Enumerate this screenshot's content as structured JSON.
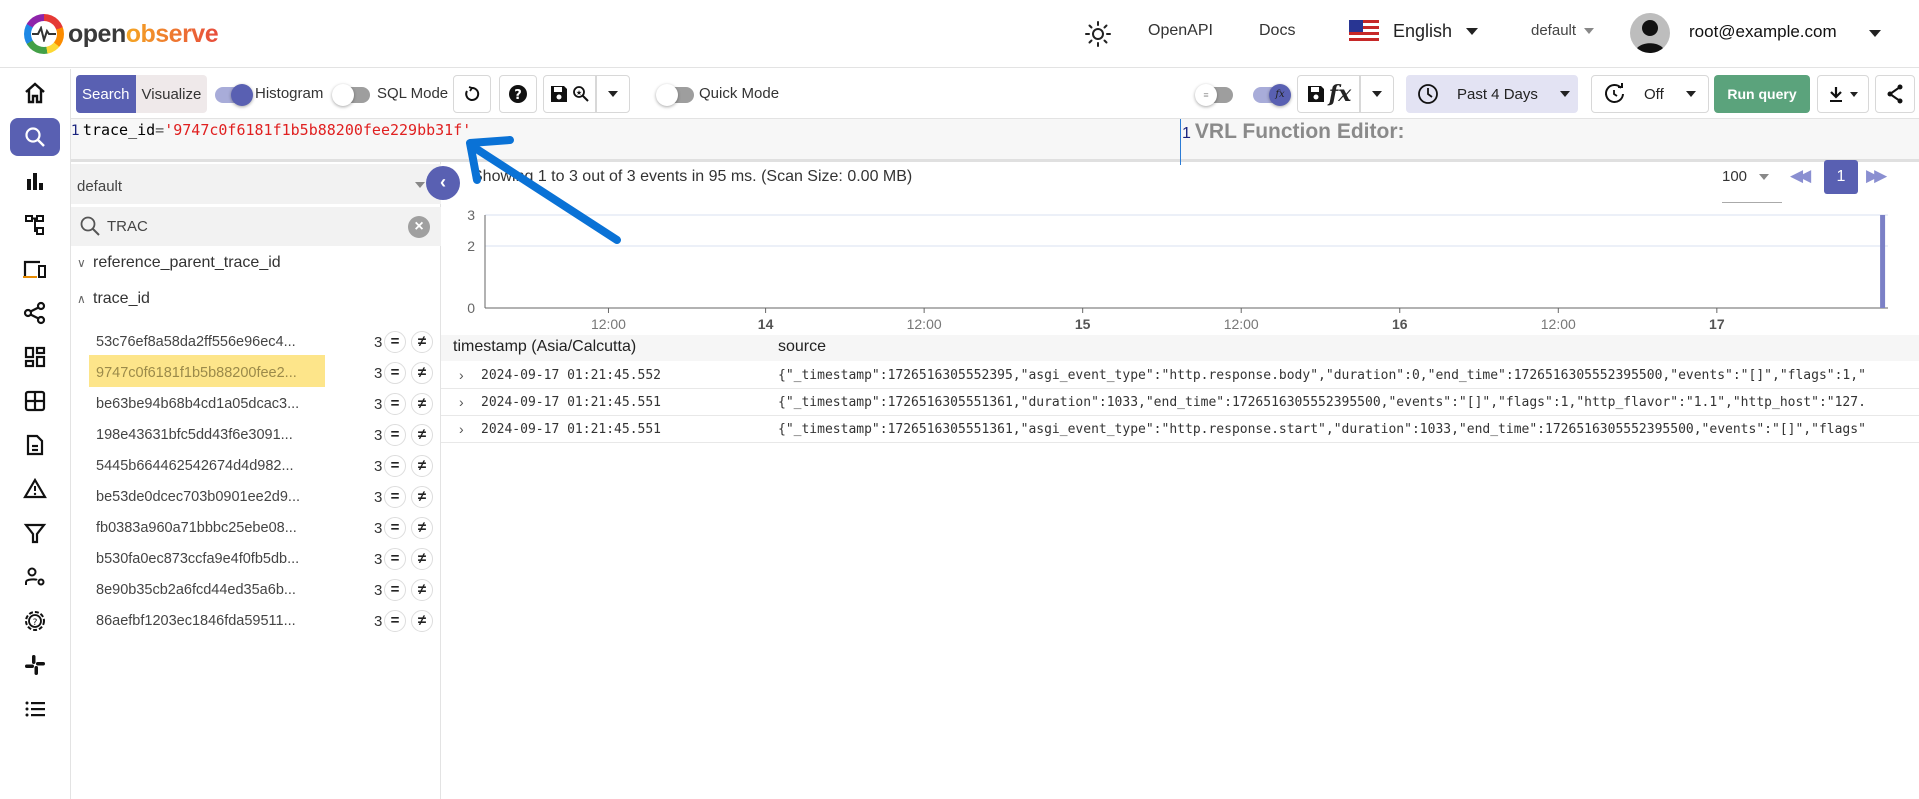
{
  "header": {
    "logo_part1": "open",
    "logo_part2": "observe",
    "openapi": "OpenAPI",
    "docs": "Docs",
    "language": "English",
    "org": "default",
    "user": "root@example.com"
  },
  "nav": [
    "home-icon",
    "search-icon",
    "metrics-icon",
    "traces-icon",
    "rum-icon",
    "pipelines-icon",
    "dashboards-icon",
    "streams-icon",
    "reports-icon",
    "alerts-icon",
    "ingestion-icon",
    "iam-icon",
    "settings-icon",
    "slack-icon",
    "about-icon"
  ],
  "toolbar": {
    "search_tab": "Search",
    "visualize_tab": "Visualize",
    "histogram_label": "Histogram",
    "histogram_on": true,
    "sql_mode_label": "SQL Mode",
    "sql_mode_on": false,
    "quick_mode_label": "Quick Mode",
    "quick_mode_on": false,
    "wrap_on": false,
    "fx_on": true,
    "date_range": "Past 4 Days",
    "refresh": "Off",
    "run_query": "Run query",
    "accent": "#5960b2",
    "run_color": "#5ba37c"
  },
  "query": {
    "line_number": "1",
    "key": "trace_id",
    "operator": "=",
    "value": "'9747c0f6181f1b5b88200fee229bb31f'",
    "vrl_line_number": "1",
    "vrl_placeholder": "VRL Function Editor:"
  },
  "left_panel": {
    "stream": "default",
    "field_search": "TRAC",
    "fields": [
      {
        "name": "reference_parent_trace_id",
        "expanded": false
      },
      {
        "name": "trace_id",
        "expanded": true
      }
    ],
    "trace_values": [
      {
        "value": "53c76ef8a58da2ff556e96ec4...",
        "count": "3",
        "highlighted": false
      },
      {
        "value": "9747c0f6181f1b5b88200fee2...",
        "count": "3",
        "highlighted": true
      },
      {
        "value": "be63be94b68b4cd1a05dcac3...",
        "count": "3",
        "highlighted": false
      },
      {
        "value": "198e43631bfc5dd43f6e3091...",
        "count": "3",
        "highlighted": false
      },
      {
        "value": "5445b664462542674d4d982...",
        "count": "3",
        "highlighted": false
      },
      {
        "value": "be53de0dcec703b0901ee2d9...",
        "count": "3",
        "highlighted": false
      },
      {
        "value": "fb0383a960a71bbbc25ebe08...",
        "count": "3",
        "highlighted": false
      },
      {
        "value": "b530fa0ec873ccfa9e4f0fb5db...",
        "count": "3",
        "highlighted": false
      },
      {
        "value": "8e90b35cb2a6fcd44ed35a6b...",
        "count": "3",
        "highlighted": false
      },
      {
        "value": "86aefbf1203ec1846fda59511...",
        "count": "3",
        "highlighted": false
      }
    ],
    "include_symbol": "=",
    "exclude_symbol": "≠"
  },
  "results": {
    "summary": "Showing 1 to 3 out of 3 events in 95 ms. (Scan Size: 0.00 MB)",
    "per_page": "100",
    "current_page": "1",
    "columns": [
      "timestamp (Asia/Calcutta)",
      "source"
    ],
    "rows": [
      {
        "timestamp": "2024-09-17 01:21:45.552",
        "source": "{\"_timestamp\":1726516305552395,\"asgi_event_type\":\"http.response.body\",\"duration\":0,\"end_time\":1726516305552395500,\"events\":\"[]\",\"flags\":1,\""
      },
      {
        "timestamp": "2024-09-17 01:21:45.551",
        "source": "{\"_timestamp\":1726516305551361,\"duration\":1033,\"end_time\":1726516305552395500,\"events\":\"[]\",\"flags\":1,\"http_flavor\":\"1.1\",\"http_host\":\"127."
      },
      {
        "timestamp": "2024-09-17 01:21:45.551",
        "source": "{\"_timestamp\":1726516305551361,\"asgi_event_type\":\"http.response.start\",\"duration\":1033,\"end_time\":1726516305552395500,\"events\":\"[]\",\"flags\""
      }
    ]
  },
  "chart_data": {
    "type": "bar",
    "title": "",
    "xlabel": "",
    "ylabel": "",
    "x_ticks": [
      {
        "label": "12:00",
        "pos": 0.088,
        "bold": false
      },
      {
        "label": "14",
        "pos": 0.2,
        "bold": true
      },
      {
        "label": "12:00",
        "pos": 0.313,
        "bold": false
      },
      {
        "label": "15",
        "pos": 0.426,
        "bold": true
      },
      {
        "label": "12:00",
        "pos": 0.539,
        "bold": false
      },
      {
        "label": "16",
        "pos": 0.652,
        "bold": true
      },
      {
        "label": "12:00",
        "pos": 0.765,
        "bold": false
      },
      {
        "label": "17",
        "pos": 0.878,
        "bold": true
      }
    ],
    "y_ticks": [
      0,
      2,
      3
    ],
    "ylim": [
      0,
      3
    ],
    "bars": [
      {
        "x_pos": 0.9965,
        "value": 3
      }
    ],
    "bar_color": "#7b80c6",
    "grid": true
  },
  "annotation": {
    "type": "arrow",
    "color": "#0a72d6"
  }
}
